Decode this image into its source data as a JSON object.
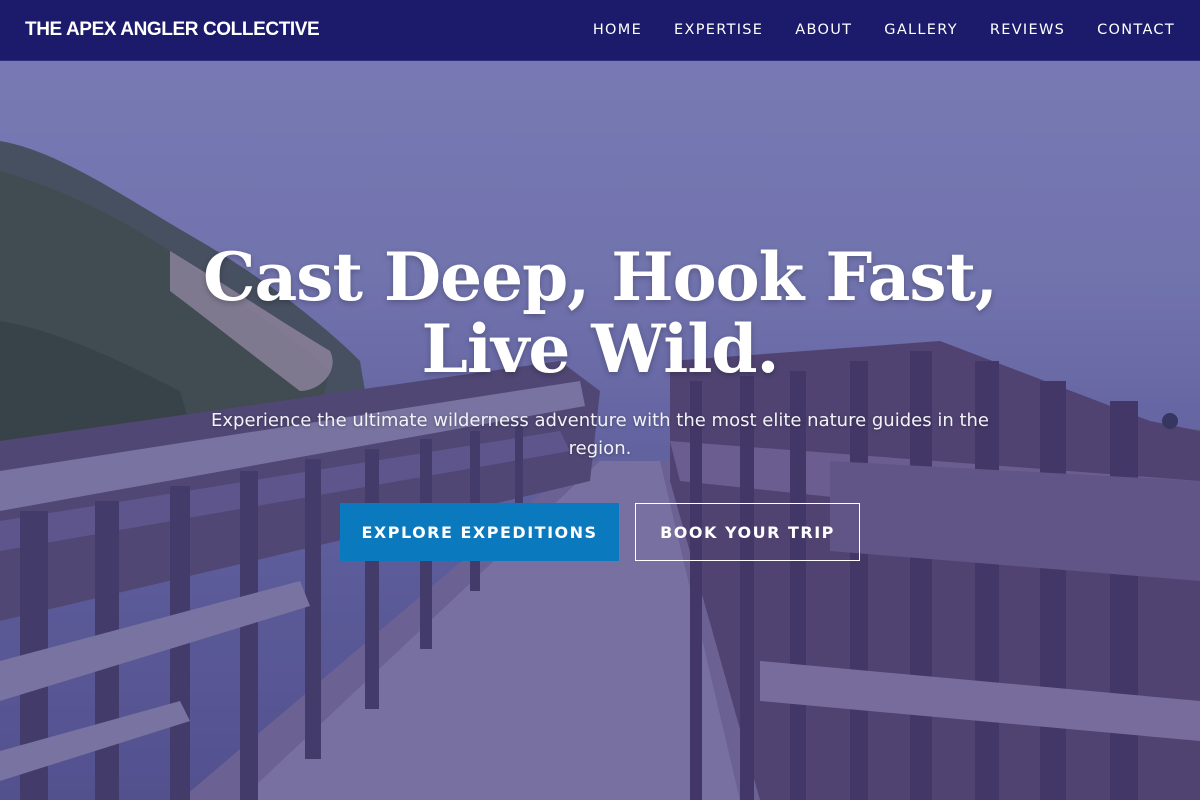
{
  "nav": {
    "brand": "THE APEX ANGLER COLLECTIVE",
    "links": [
      "HOME",
      "EXPERTISE",
      "ABOUT",
      "GALLERY",
      "REVIEWS",
      "CONTACT"
    ]
  },
  "hero": {
    "headline_line1": "Cast Deep, Hook Fast,",
    "headline_line2": "Live Wild.",
    "subtext": "Experience the ultimate wilderness adventure with the most elite nature guides in the region.",
    "primary_cta": "EXPLORE EXPEDITIONS",
    "secondary_cta": "BOOK YOUR TRIP",
    "background_image": "wooden boardwalk through coastal dunes"
  },
  "colors": {
    "nav_bg": "#1b1a6b",
    "primary_button": "#0a79be",
    "text": "#ffffff"
  }
}
